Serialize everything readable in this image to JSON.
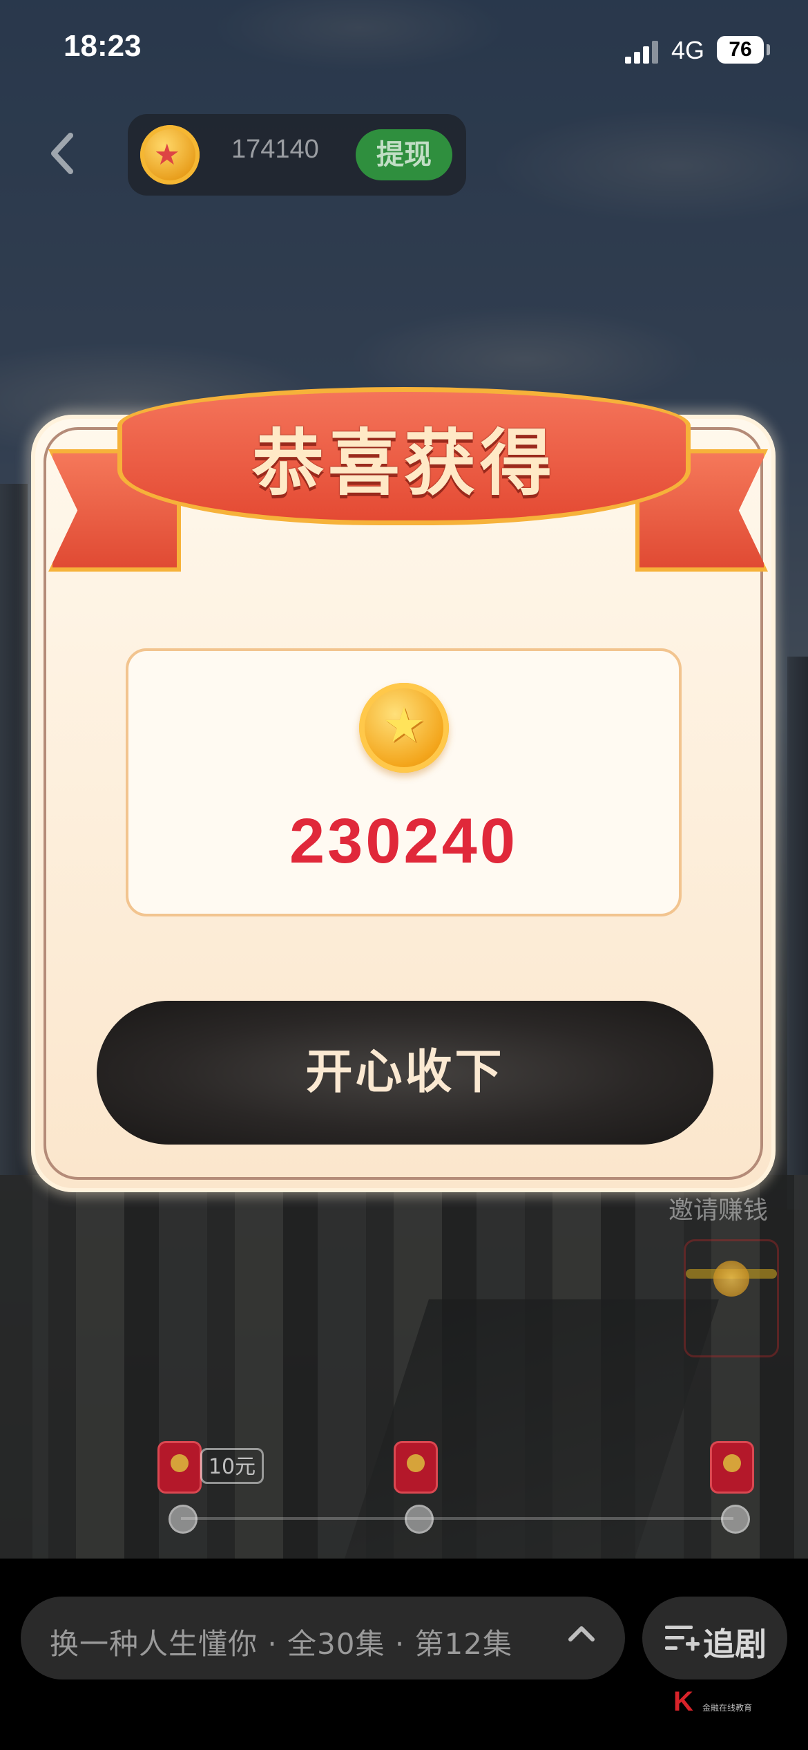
{
  "status_bar": {
    "time": "18:23",
    "network": "4G",
    "battery": "76"
  },
  "header": {
    "coin_balance": "174140",
    "withdraw_label": "提现"
  },
  "dialog": {
    "title": "恭喜获得",
    "reward_amount": "230240",
    "accept_label": "开心收下"
  },
  "background": {
    "invite_label": "邀请赚钱",
    "reward_tag": "10元"
  },
  "player_bar": {
    "episode_info": "换一种人生懂你 · 全30集 · 第12集",
    "follow_label": "追剧"
  },
  "watermark": {
    "brand_text": "金融在线教育"
  },
  "colors": {
    "accent_red": "#e0283a",
    "button_dark": "#2a2726",
    "gold": "#f3a51b",
    "ribbon_red": "#e44a33"
  }
}
